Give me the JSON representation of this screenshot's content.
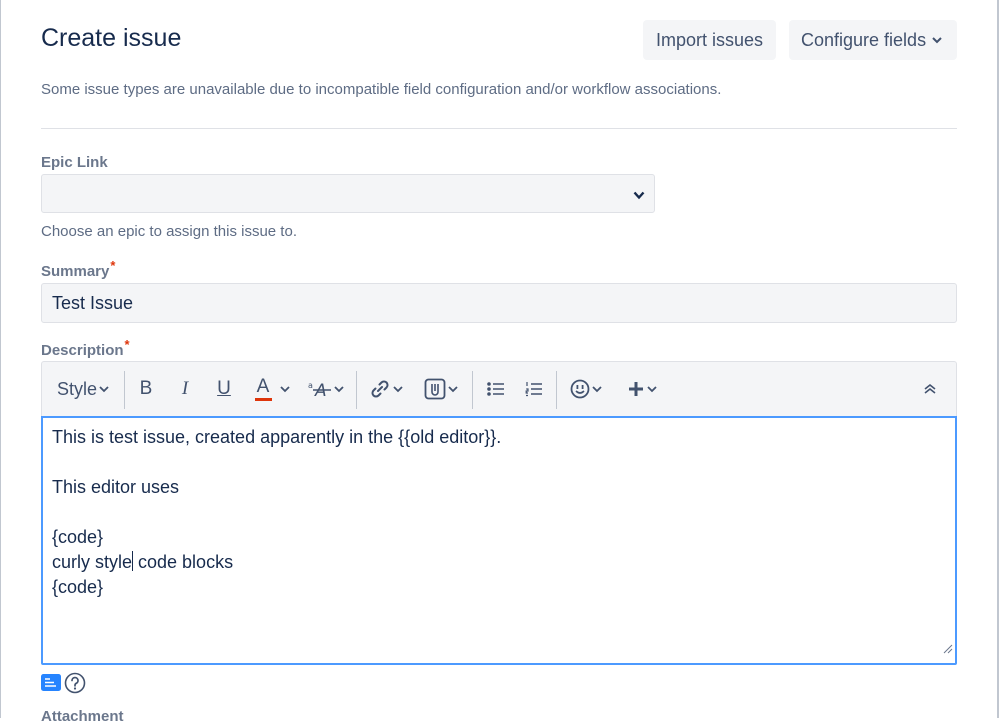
{
  "dialog": {
    "title": "Create issue",
    "import_label": "Import issues",
    "configure_label": "Configure fields",
    "notice": "Some issue types are unavailable due to incompatible field configuration and/or workflow associations."
  },
  "fields": {
    "epic": {
      "label": "Epic Link",
      "value": "",
      "help": "Choose an epic to assign this issue to."
    },
    "summary": {
      "label": "Summary",
      "required_marker": "*",
      "value": "Test Issue"
    },
    "description": {
      "label": "Description",
      "required_marker": "*",
      "toolbar": {
        "style_label": "Style",
        "bold_label": "B",
        "italic_label": "I",
        "underline_label": "U",
        "color_label": "A",
        "color_underline": "#de350b",
        "buttons": [
          "style",
          "bold",
          "italic",
          "underline",
          "text-color",
          "text-effects",
          "link",
          "attachment",
          "bullet-list",
          "numbered-list",
          "emoji",
          "insert-more",
          "collapse-toolbar"
        ]
      },
      "lines": [
        "This is test issue, created apparently in the {{old editor}}.",
        "",
        "This editor uses",
        "",
        "{code}",
        "curly style",
        " code blocks",
        "{code}"
      ]
    },
    "next_field_label": "Attachment"
  },
  "colors": {
    "focus": "#4c9aff",
    "required": "#de350b",
    "wiki_icon": "#2684ff"
  },
  "icons": [
    "chevron-down-icon",
    "bold-icon",
    "italic-icon",
    "underline-icon",
    "text-color-icon",
    "text-effects-icon",
    "link-icon",
    "attachment-icon",
    "bullet-list-icon",
    "numbered-list-icon",
    "emoji-icon",
    "plus-icon",
    "collapse-icon",
    "wiki-markup-icon",
    "help-icon",
    "resize-handle-icon"
  ]
}
